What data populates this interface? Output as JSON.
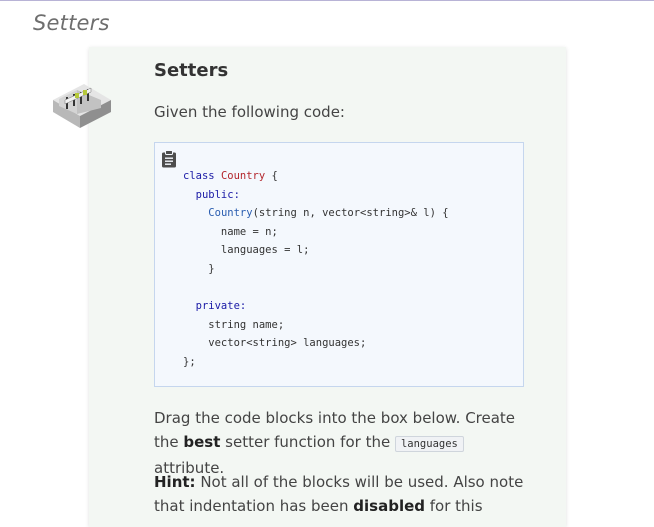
{
  "page": {
    "heading": "Setters"
  },
  "card": {
    "title": "Setters",
    "intro": "Given the following code:",
    "code_lines": [
      [
        {
          "t": "class ",
          "c": "kw"
        },
        {
          "t": "Country",
          "c": "type"
        },
        {
          "t": " {",
          "c": ""
        }
      ],
      [
        {
          "t": "  public:",
          "c": "kw"
        }
      ],
      [
        {
          "t": "    ",
          "c": ""
        },
        {
          "t": "Country",
          "c": "fn"
        },
        {
          "t": "(string n, vector<string>& l) {",
          "c": ""
        }
      ],
      [
        {
          "t": "      name = n;",
          "c": ""
        }
      ],
      [
        {
          "t": "      languages = l;",
          "c": ""
        }
      ],
      [
        {
          "t": "    }",
          "c": ""
        }
      ],
      [
        {
          "t": "",
          "c": ""
        }
      ],
      [
        {
          "t": "  private:",
          "c": "kw"
        }
      ],
      [
        {
          "t": "    string name;",
          "c": ""
        }
      ],
      [
        {
          "t": "    vector<string> languages;",
          "c": ""
        }
      ],
      [
        {
          "t": "};",
          "c": ""
        }
      ]
    ],
    "drag": {
      "pre": "Drag the code blocks into the box below. Create the ",
      "bold": "best",
      "mid": " setter function for the ",
      "code": "languages",
      "post": " attribute."
    },
    "hint": {
      "label": "Hint:",
      "pre": " Not all of the blocks will be used. Also note that indentation has been ",
      "bold": "disabled",
      "post": " for this"
    }
  }
}
